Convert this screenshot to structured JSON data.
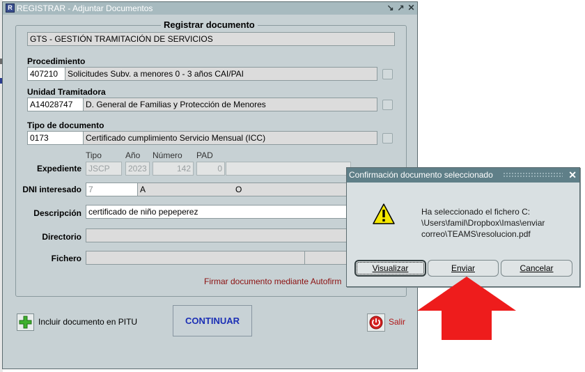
{
  "window": {
    "title": "REGISTRAR - Adjuntar Documentos"
  },
  "form": {
    "group_title": "Registrar documento",
    "organismo": "GTS - GESTIÓN TRAMITACIÓN DE SERVICIOS",
    "procedimiento": {
      "label": "Procedimiento",
      "code": "407210",
      "description": "Solicitudes Subv. a menores 0 - 3 años CAI/PAI"
    },
    "unidad": {
      "label": "Unidad Tramitadora",
      "code": "A14028747",
      "description": "D. General de Familias y Protección de Menores"
    },
    "tipo_doc": {
      "label": "Tipo de documento",
      "code": "0173",
      "description": "Certificado cumplimiento Servicio Mensual (ICC)"
    },
    "expediente": {
      "label": "Expediente",
      "col_tipo": "Tipo",
      "col_anio": "Año",
      "col_numero": "Número",
      "col_pad": "PAD",
      "tipo": "JSCP",
      "anio": "2023",
      "numero": "142",
      "pad": "0"
    },
    "dni": {
      "label": "DNI interesado",
      "value": "7",
      "name_part1": "A",
      "name_part2": "O"
    },
    "descripcion": {
      "label": "Descripción",
      "value": "certificado de niño pepeperez"
    },
    "directorio": {
      "label": "Directorio",
      "value": ""
    },
    "fichero": {
      "label": "Fichero",
      "value": ""
    },
    "firmar_label": "Firmar documento mediante Autofirm"
  },
  "actions": {
    "incluir_label": "Incluir documento en PITU",
    "continuar_label": "CONTINUAR",
    "salir_label": "Salir"
  },
  "dialog": {
    "title": "Confirmación documento seleccionado",
    "message_line1": "Ha seleccionado el fichero C:",
    "message_line2": "\\Users\\famil\\Dropbox\\Imas\\enviar",
    "message_line3": "correo\\TEAMS\\resolucion.pdf",
    "btn_visualizar": "Visualizar",
    "btn_enviar": "Enviar",
    "btn_cancelar": "Cancelar"
  },
  "icons": [
    "app-icon",
    "minimize-icon",
    "maximize-icon",
    "close-icon",
    "plus-icon",
    "power-icon",
    "warning-icon",
    "arrow-icon"
  ],
  "colors": {
    "window_bg": "#c7d1d4",
    "dialog_title": "#5f7f88",
    "continuar_text": "#1b2fb5",
    "salir_text": "#b01818",
    "arrow": "#ee1c1c",
    "warning": "#f5e800"
  }
}
